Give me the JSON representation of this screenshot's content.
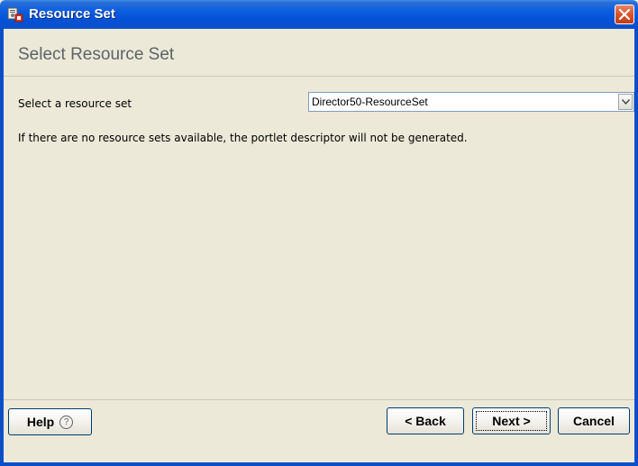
{
  "window": {
    "title": "Resource Set"
  },
  "header": {
    "title": "Select Resource Set"
  },
  "form": {
    "resource_set_label": "Select a resource set",
    "resource_set_value": "Director50-ResourceSet",
    "info_text": "If there are no resource sets available, the portlet descriptor will not be generated."
  },
  "footer": {
    "help_label": "Help",
    "help_icon_glyph": "?",
    "back_label": "< Back",
    "next_label": "Next >",
    "cancel_label": "Cancel"
  },
  "icons": {
    "title": "resource-set-icon",
    "close": "close-icon",
    "dropdown": "chevron-down-icon",
    "help": "question-circle-icon"
  },
  "colors": {
    "titlebar": "#0451d6",
    "close_button": "#d9542b",
    "window_bg": "#ece9d8",
    "page_title": "#5c6468"
  }
}
